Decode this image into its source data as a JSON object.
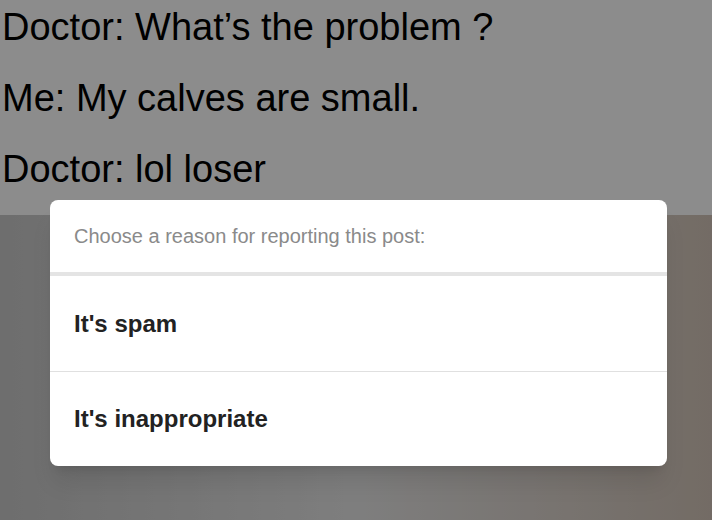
{
  "meme": {
    "lines": [
      "Doctor: What’s the problem ?",
      "Me: My calves are small.",
      "Doctor: lol loser"
    ]
  },
  "dialog": {
    "title": "Choose a reason for reporting this post:",
    "options": [
      {
        "label": "It's spam"
      },
      {
        "label": "It's inappropriate"
      }
    ]
  }
}
